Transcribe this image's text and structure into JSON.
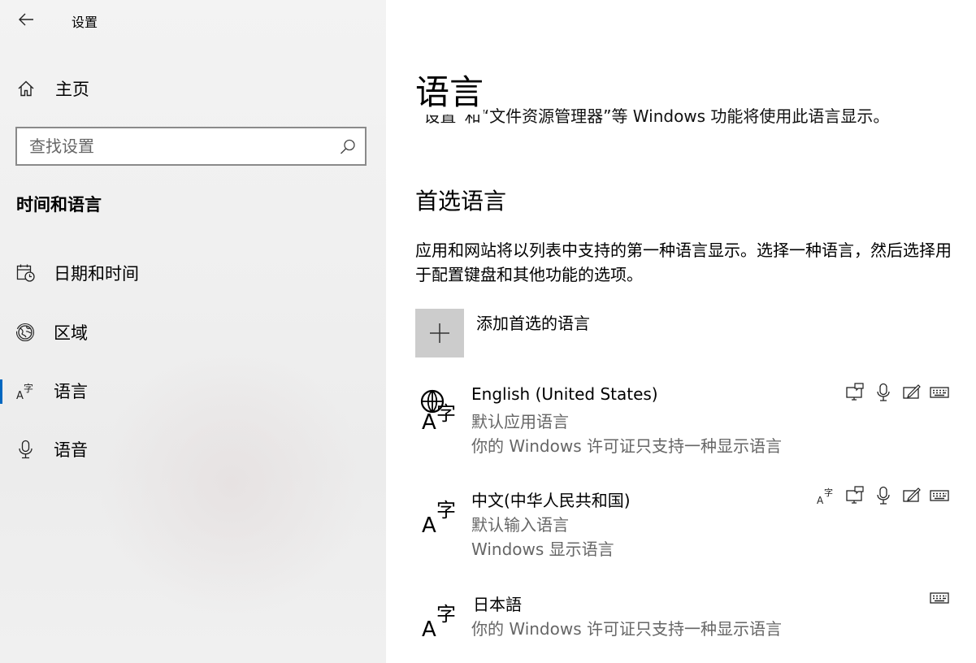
{
  "window": {
    "title": "设置"
  },
  "sidebar": {
    "home_label": "主页",
    "search": {
      "placeholder": "查找设置",
      "value": ""
    },
    "section_title": "时间和语言",
    "items": [
      {
        "label": "日期和时间",
        "icon": "calendar-clock-icon"
      },
      {
        "label": "区域",
        "icon": "globe-region-icon"
      },
      {
        "label": "语言",
        "icon": "language-icon",
        "selected": true
      },
      {
        "label": "语音",
        "icon": "microphone-icon"
      }
    ]
  },
  "main": {
    "title": "语言",
    "clipped_text": "“设置”和“文件资源管理器”等 Windows 功能将使用此语言显示。",
    "preferred": {
      "title": "首选语言",
      "description": "应用和网站将以列表中支持的第一种语言显示。选择一种语言，然后选择用于配置键盘和其他功能的选项。",
      "add_label": "添加首选的语言",
      "languages": [
        {
          "name": "English (United States)",
          "line1": "默认应用语言",
          "line2": "你的 Windows 许可证只支持一种显示语言",
          "icon": "language-globe-icon",
          "features": [
            "display-language-icon",
            "microphone-icon",
            "handwriting-icon",
            "keyboard-icon"
          ]
        },
        {
          "name": "中文(中华人民共和国)",
          "line1": "默认输入语言",
          "line2": "Windows 显示语言",
          "icon": "language-icon",
          "features": [
            "language-pack-icon",
            "display-language-icon",
            "microphone-icon",
            "handwriting-icon",
            "keyboard-icon"
          ]
        },
        {
          "name": "日本語",
          "line1": "你的 Windows 许可证只支持一种显示语言",
          "icon": "language-icon",
          "features": [
            "keyboard-icon"
          ]
        }
      ]
    }
  },
  "colors": {
    "accent": "#0067c0",
    "tile": "#cccccc",
    "secondary_text": "#666666"
  }
}
